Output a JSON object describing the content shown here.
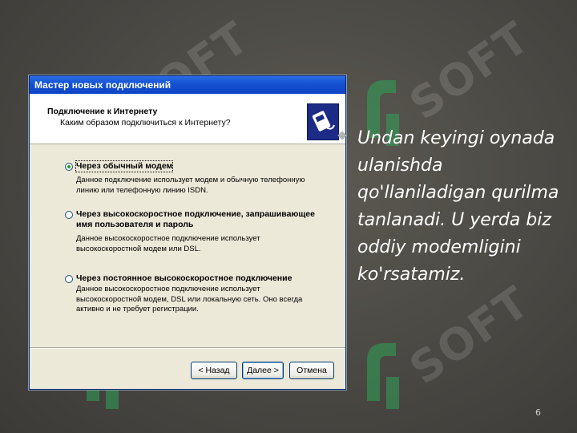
{
  "watermark": {
    "text": "SOFT",
    "logo_color": "#2fa356"
  },
  "dialog": {
    "title": "Мастер новых подключений",
    "header_title": "Подключение к Интернету",
    "header_subtitle": "Каким образом подключиться к Интернету?",
    "header_icon": "network-phone-icon",
    "options": [
      {
        "label": "Через обычный модем",
        "description": "Данное подключение использует модем и обычную телефонную линию или телефонную линию ISDN.",
        "selected": true
      },
      {
        "label": "Через высокоскоростное подключение, запрашивающее имя пользователя и пароль",
        "description": "Данное высокоскоростное подключение использует высокоскоростной модем или DSL.",
        "selected": false
      },
      {
        "label": "Через постоянное высокоскоростное подключение",
        "description": "Данное высокоскоростное подключение использует высокоскоростной модем, DSL или локальную сеть. Оно всегда активно и не требует регистрации.",
        "selected": false
      }
    ],
    "buttons": {
      "back": "< Назад",
      "next": "Далее >",
      "cancel": "Отмена"
    }
  },
  "slide": {
    "text": "Undan keyingi oynada ulanishda qo'llaniladigan qurilma tanlanadi. U yerda biz oddiy modemligini ko'rsatamiz.",
    "page_number": "6"
  },
  "colors": {
    "background": "#4a4843",
    "titlebar": "#1553d3",
    "dialog_bg": "#ece9d8",
    "text_white": "#ffffff"
  }
}
